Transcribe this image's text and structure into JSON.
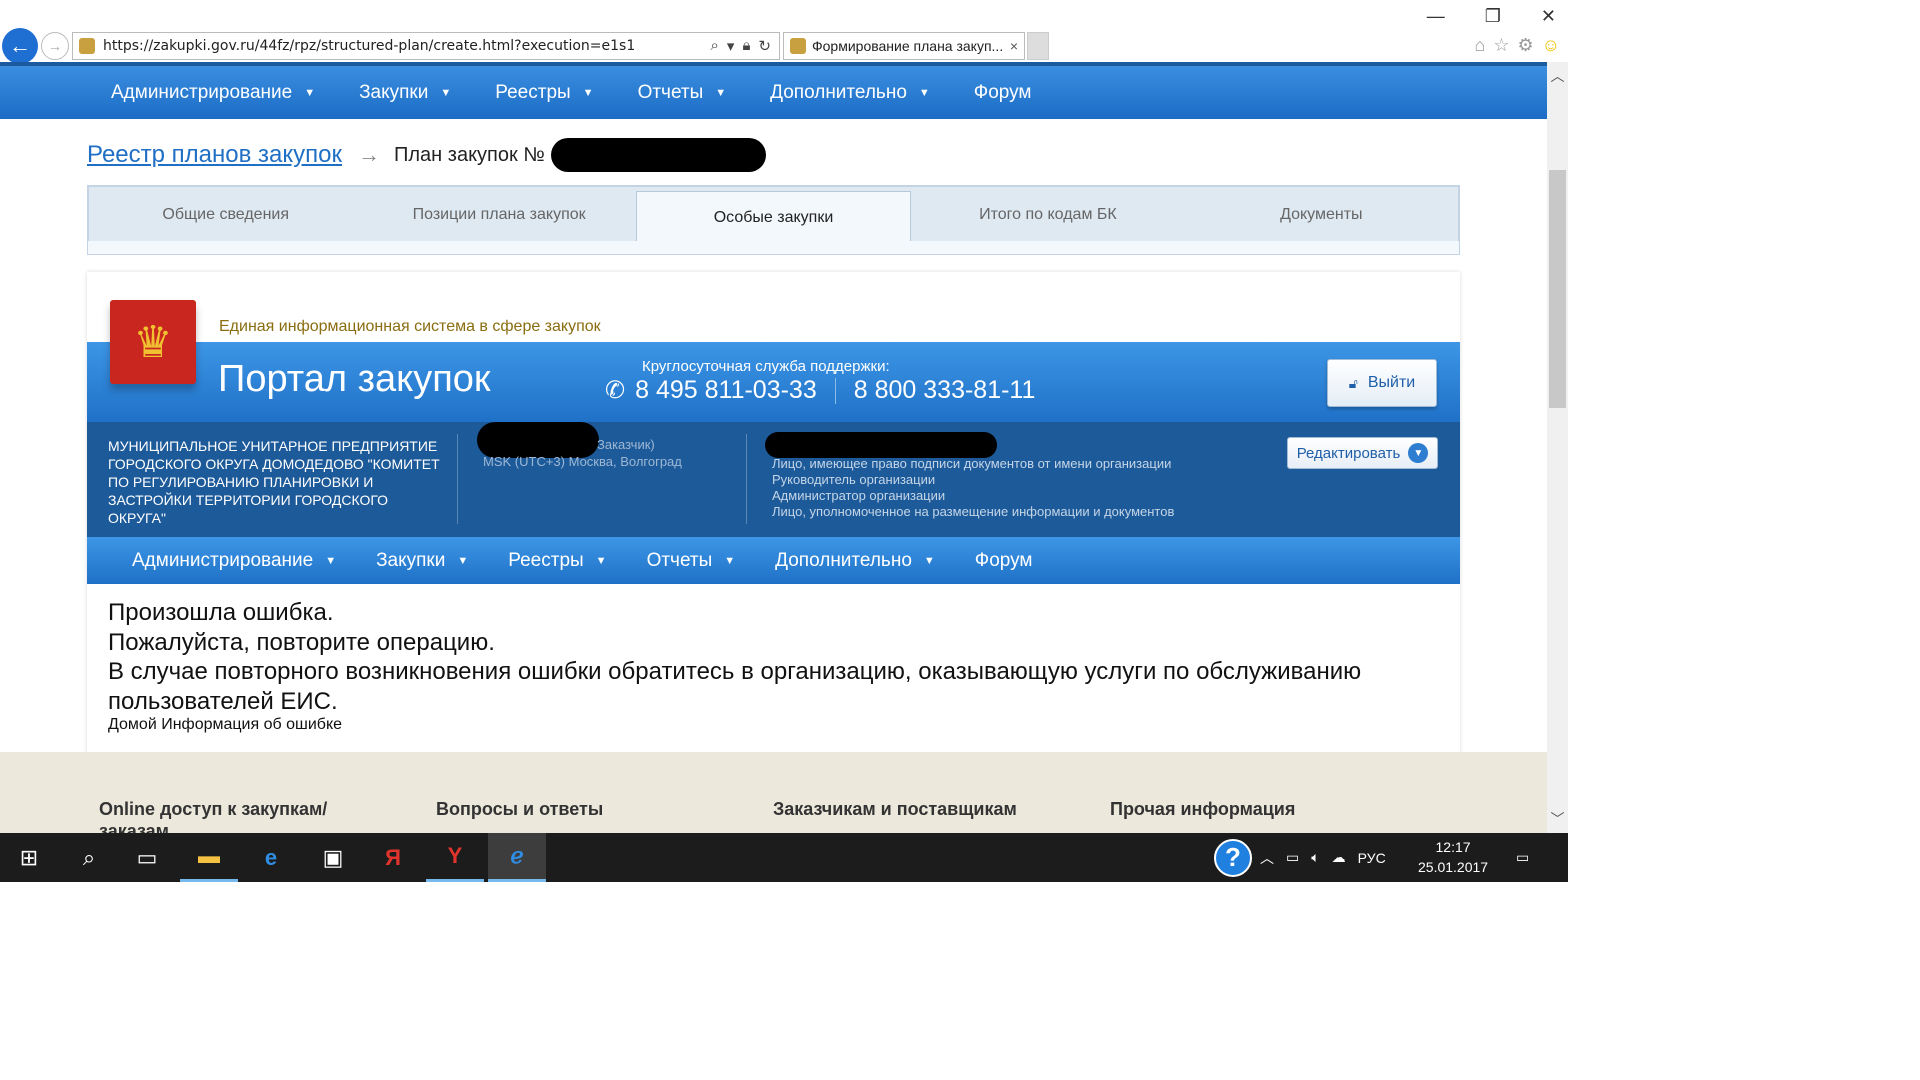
{
  "browser": {
    "url": "https://zakupki.gov.ru/44fz/rpz/structured-plan/create.html?execution=e1s1",
    "tab_title": "Формирование плана закуп...",
    "tab_close": "×",
    "window_buttons": {
      "minimize": "—",
      "restore": "❐",
      "close": "✕"
    }
  },
  "topnav": {
    "items": [
      {
        "label": "Администрирование",
        "dropdown": true
      },
      {
        "label": "Закупки",
        "dropdown": true
      },
      {
        "label": "Реестры",
        "dropdown": true
      },
      {
        "label": "Отчеты",
        "dropdown": true
      },
      {
        "label": "Дополнительно",
        "dropdown": true
      },
      {
        "label": "Форум",
        "dropdown": false
      }
    ]
  },
  "breadcrumb": {
    "link": "Реестр планов закупок",
    "current": "План закупок №"
  },
  "tabs": [
    {
      "label": "Общие сведения",
      "active": false
    },
    {
      "label": "Позиции плана закупок",
      "active": false
    },
    {
      "label": "Особые закупки",
      "active": true
    },
    {
      "label": "Итого по кодам БК",
      "active": false
    },
    {
      "label": "Документы",
      "active": false
    }
  ],
  "header": {
    "eis_title": "Единая информационная система в сфере закупок",
    "portal_title": "Портал закупок",
    "support_label": "Круглосуточная служба поддержки:",
    "phone1": "8 495 811-03-33",
    "phone2": "8 800 333-81-11",
    "logout_label": "Выйти"
  },
  "org": {
    "name": "МУНИЦИПАЛЬНОЕ УНИТАРНОЕ ПРЕДПРИЯТИЕ ГОРОДСКОГО ОКРУГА ДОМОДЕДОВО \"КОМИТЕТ ПО РЕГУЛИРОВАНИЮ ПЛАНИРОВКИ И ЗАСТРОЙКИ ТЕРРИТОРИИ ГОРОДСКОГО ОКРУГА\"",
    "role_suffix": "Заказчик)",
    "timezone": "MSK (UTC+3) Москва, Волгоград",
    "roles": [
      "Лицо, имеющее право подписи документов от имени организации",
      "Руководитель организации",
      "Администратор организации",
      "Лицо, уполномоченное на размещение информации и документов"
    ],
    "edit_label": "Редактировать"
  },
  "subnav": {
    "items": [
      {
        "label": "Администрирование",
        "dropdown": true
      },
      {
        "label": "Закупки",
        "dropdown": true
      },
      {
        "label": "Реестры",
        "dropdown": true
      },
      {
        "label": "Отчеты",
        "dropdown": true
      },
      {
        "label": "Дополнительно",
        "dropdown": true
      },
      {
        "label": "Форум",
        "dropdown": false
      }
    ]
  },
  "error": {
    "line1": "Произошла ошибка.",
    "line2": "Пожалуйста, повторите операцию.",
    "line3": "В случае повторного возникновения ошибки обратитесь в организацию, оказывающую услуги по обслуживанию пользователей ЕИС.",
    "links": "Домой Информация об ошибке"
  },
  "footer": {
    "columns": [
      "Online доступ к закупкам/заказам",
      "Вопросы и ответы",
      "Заказчикам и поставщикам",
      "Прочая информация"
    ]
  },
  "taskbar": {
    "language": "РУС",
    "time": "12:17",
    "date": "25.01.2017"
  },
  "colors": {
    "nav_blue": "#1f71c7",
    "org_bar": "#1d5a99",
    "link_blue": "#1f6fc5",
    "eis_gold": "#8a6d10"
  }
}
